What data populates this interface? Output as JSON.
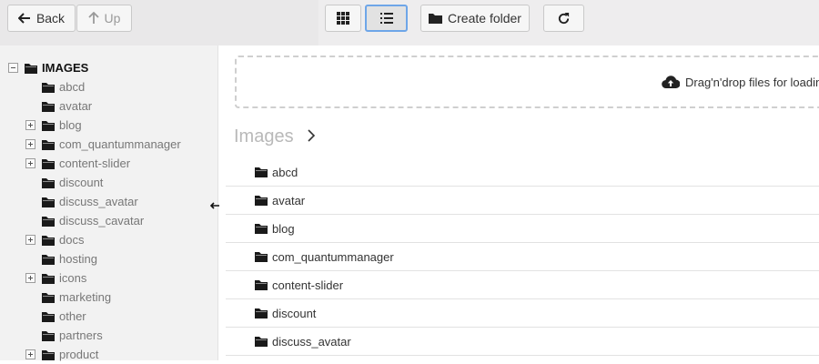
{
  "toolbar": {
    "back_label": "Back",
    "up_label": "Up",
    "grid_view_icon": "grid-icon",
    "list_view_icon": "list-icon",
    "create_folder_label": "Create folder",
    "refresh_icon": "refresh-icon"
  },
  "tree": {
    "root_label": "IMAGES",
    "items": [
      {
        "label": "abcd",
        "expandable": false
      },
      {
        "label": "avatar",
        "expandable": false
      },
      {
        "label": "blog",
        "expandable": true
      },
      {
        "label": "com_quantummanager",
        "expandable": true
      },
      {
        "label": "content-slider",
        "expandable": true
      },
      {
        "label": "discount",
        "expandable": false
      },
      {
        "label": "discuss_avatar",
        "expandable": false
      },
      {
        "label": "discuss_cavatar",
        "expandable": false
      },
      {
        "label": "docs",
        "expandable": true
      },
      {
        "label": "hosting",
        "expandable": false
      },
      {
        "label": "icons",
        "expandable": true
      },
      {
        "label": "marketing",
        "expandable": false
      },
      {
        "label": "other",
        "expandable": false
      },
      {
        "label": "partners",
        "expandable": false
      },
      {
        "label": "product",
        "expandable": true
      }
    ]
  },
  "content": {
    "dropzone_text": "Drag'n'drop files for loadin",
    "breadcrumb": "Images",
    "files": [
      "abcd",
      "avatar",
      "blog",
      "com_quantummanager",
      "content-slider",
      "discount",
      "discuss_avatar"
    ]
  },
  "colors": {
    "toolbar_bg": "#e9e8e9",
    "tree_bg": "#f2f2f2",
    "active_border": "#6ea6e8"
  }
}
